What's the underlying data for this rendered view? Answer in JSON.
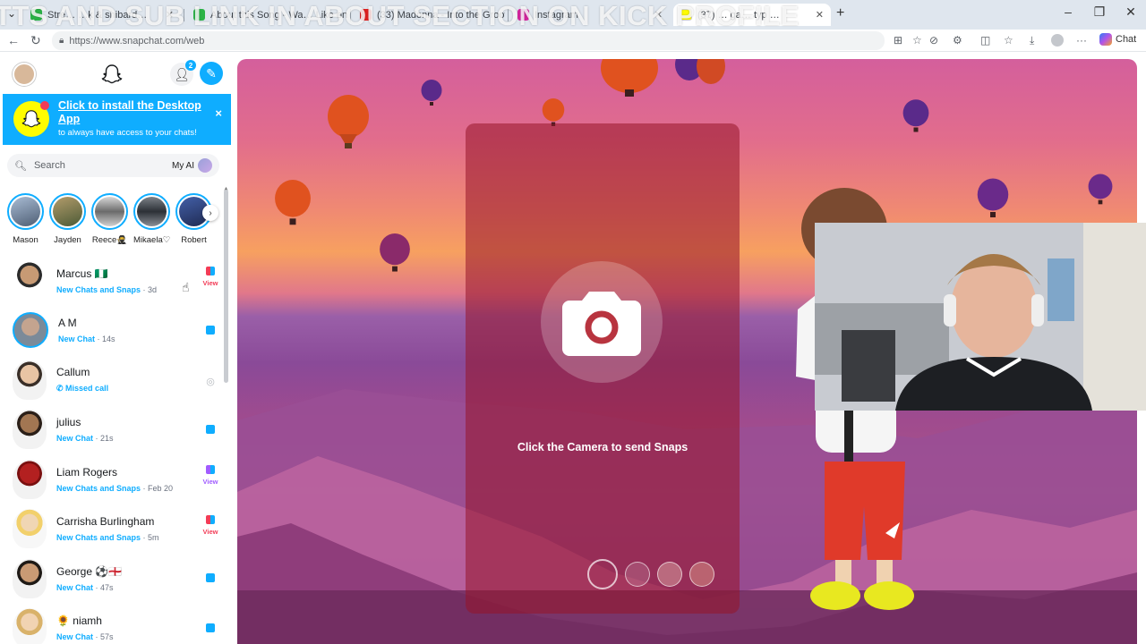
{
  "browser": {
    "tabs": [
      {
        "label": "Stre… …k & shibard…",
        "fav": "#2ab346"
      },
      {
        "label": "About this Song - Wa… Like on …",
        "fav": "#2ab346"
      },
      {
        "label": "(33) Madonna - Into the Groove",
        "fav": "#e02020"
      },
      {
        "label": "Instagram",
        "fav": "#d6249f"
      },
      {
        "label": "(37) … ga… typ …",
        "fav": "#fffc00"
      }
    ],
    "overlay_text": "TTS AND SUB LINK IN ABOUT SECTION ON KICK PROFILE",
    "url": "https://www.snapchat.com/web",
    "chat_label": "Chat"
  },
  "sidebar": {
    "friend_request_count": "2",
    "install_banner": {
      "title": "Click to install the Desktop App",
      "subtitle": "to always have access to your chats!",
      "close": "×"
    },
    "search": {
      "placeholder": "Search",
      "my_ai": "My AI"
    },
    "stories": [
      {
        "name": "Mason",
        "color": "#6b7f9a"
      },
      {
        "name": "Jayden",
        "color": "#7a6a4a"
      },
      {
        "name": "Reece🥷",
        "color": "#8a8a8a"
      },
      {
        "name": "Mikaela♡",
        "color": "#555a60"
      },
      {
        "name": "Robert",
        "color": "#3b4c7a"
      }
    ],
    "chats": [
      {
        "name": "Marcus 🇳🇬",
        "status": "New Chats and Snaps",
        "time": " · 3d",
        "action": "View",
        "type": "both",
        "skin": "#c79a74"
      },
      {
        "name": "A M",
        "status": "New Chat",
        "time": " · 14s",
        "action": "",
        "type": "chat",
        "skin": "#c4a48f"
      },
      {
        "name": "Callum",
        "status": "Missed call",
        "time": "",
        "action": "",
        "type": "missed",
        "skin": "#e8c4a4"
      },
      {
        "name": "julius",
        "status": "New Chat",
        "time": " · 21s",
        "action": "",
        "type": "chat",
        "skin": "#a27652"
      },
      {
        "name": "Liam Rogers",
        "status": "New Chats and Snaps",
        "time": " · Feb 20",
        "action": "View",
        "type": "both-purple",
        "skin": "#b32020"
      },
      {
        "name": "Carrisha Burlingham",
        "status": "New Chats and Snaps",
        "time": " · 5m",
        "action": "View",
        "type": "both",
        "skin": "#f0d6b4"
      },
      {
        "name": "George ⚽🏴󠁧󠁢󠁥󠁮󠁧󠁿",
        "status": "New Chat",
        "time": " · 47s",
        "action": "",
        "type": "chat",
        "skin": "#c99a74"
      },
      {
        "name": "🌻 niamh",
        "status": "New Chat",
        "time": " · 57s",
        "action": "",
        "type": "chat",
        "skin": "#f1d3b2"
      }
    ]
  },
  "camera": {
    "prompt": "Click the Camera to send Snaps"
  },
  "colors": {
    "snap_blue": "#0fadff",
    "snap_yellow": "#fffc00",
    "snap_red": "#f23c57"
  }
}
